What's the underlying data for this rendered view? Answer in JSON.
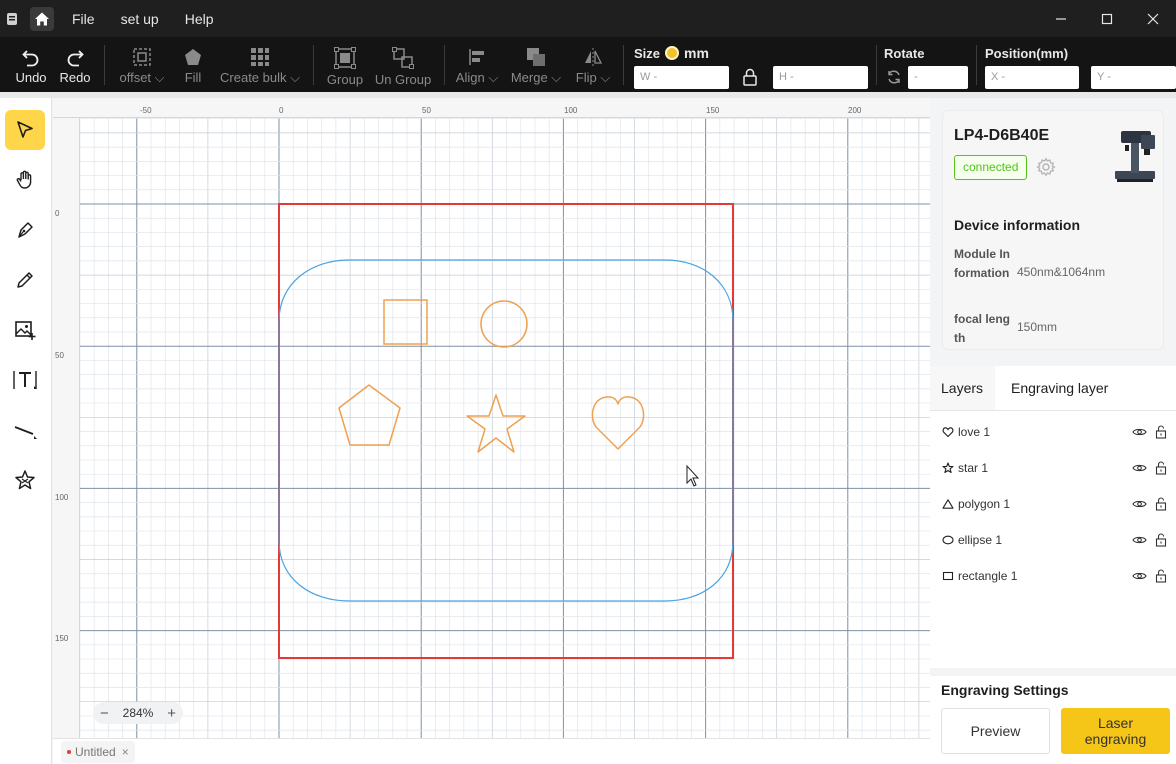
{
  "menu": {
    "file": "File",
    "setup": "set up",
    "help": "Help"
  },
  "toolbar": {
    "undo": "Undo",
    "redo": "Redo",
    "offset": "offset",
    "fill": "Fill",
    "create_bulk": "Create bulk",
    "group": "Group",
    "ungroup": "Un Group",
    "align": "Align",
    "merge": "Merge",
    "flip": "Flip",
    "size_label": "Size",
    "size_unit": "mm",
    "w_placeholder": "W -",
    "h_placeholder": "H -",
    "rotate_label": "Rotate",
    "rotate_placeholder": "-",
    "position_label": "Position(mm)",
    "x_placeholder": "X -",
    "y_placeholder": "Y -"
  },
  "left_tools": [
    "select-tool",
    "hand-tool",
    "pen-tool",
    "pencil-tool",
    "image-tool",
    "text-tool",
    "line-tool",
    "shape-tool"
  ],
  "canvas": {
    "ruler_top": [
      "-50",
      "0",
      "50",
      "100",
      "150",
      "200"
    ],
    "ruler_left": [
      "0",
      "50",
      "100",
      "150"
    ],
    "zoom": "284%",
    "shape_color": "#f0a050",
    "workarea_color": "#e53935",
    "board_color": "#4aa3e0"
  },
  "doc_tab": {
    "name": "Untitled",
    "close": "×"
  },
  "device": {
    "name": "LP4-D6B40E",
    "status": "connected",
    "info_title": "Device information",
    "module_key": "Module Information",
    "module_val": "450nm&1064nm",
    "focal_key": "focal length",
    "focal_val": "150mm"
  },
  "layers_panel": {
    "tab_layers": "Layers",
    "tab_engraving": "Engraving layer",
    "items": [
      {
        "icon": "heart-icon",
        "name": "love 1"
      },
      {
        "icon": "star-icon",
        "name": "star 1"
      },
      {
        "icon": "triangle-icon",
        "name": "polygon 1"
      },
      {
        "icon": "ellipse-icon",
        "name": "ellipse 1"
      },
      {
        "icon": "rectangle-icon",
        "name": "rectangle 1"
      }
    ]
  },
  "engraving": {
    "title": "Engraving Settings",
    "preview": "Preview",
    "laser": "Laser engraving"
  }
}
